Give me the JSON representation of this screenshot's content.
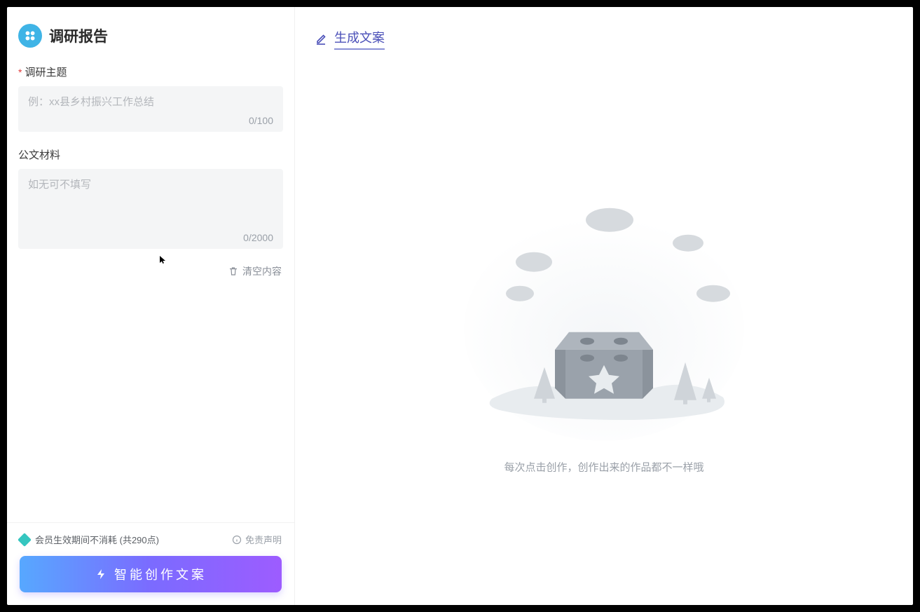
{
  "form": {
    "title": "调研报告",
    "topicLabel": "调研主题",
    "topicPlaceholder": "例：xx县乡村振兴工作总结",
    "topicCounter": "0/100",
    "materialLabel": "公文材料",
    "materialPlaceholder": "如无可不填写",
    "materialCounter": "0/2000",
    "clear": "清空内容"
  },
  "footer": {
    "membership": "会员生效期间不消耗 (共290点)",
    "disclaimer": "免责声明",
    "generate": "智能创作文案"
  },
  "right": {
    "headerAction": "生成文案",
    "emptyText": "每次点击创作，创作出来的作品都不一样哦"
  }
}
